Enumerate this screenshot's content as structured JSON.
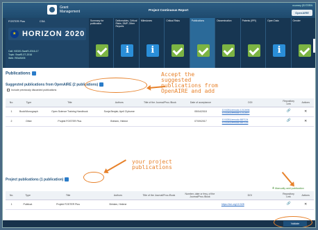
{
  "header": {
    "logo_text_1": "Grant",
    "logo_text_2": "Management",
    "report_title": "Project Continuous Report",
    "user": "ncurney (EXTERN",
    "brand": "OpenAIRE"
  },
  "project": {
    "acronym": "FOSTER Plus",
    "call": "CSA",
    "programme": "HORIZON 2020",
    "meta_1": "Call: H2020-SwafS-2016-17",
    "meta_2": "Topic: SwafS-07-2016",
    "meta_3": "Web: REA/B/05"
  },
  "tabs": [
    {
      "label": "Summary for publication",
      "status": "check"
    },
    {
      "label": "Deliverables, Critical Risks, DMP, Other Reports",
      "status": "info"
    },
    {
      "label": "Milestones",
      "status": "info"
    },
    {
      "label": "Critical Risks",
      "status": "check"
    },
    {
      "label": "Publications",
      "status": "check"
    },
    {
      "label": "Dissemination",
      "status": "check"
    },
    {
      "label": "Patents (IPR)",
      "status": "check"
    },
    {
      "label": "Open Data",
      "status": "info"
    },
    {
      "label": "Gender",
      "status": "check"
    }
  ],
  "publications": {
    "section_title": "Publications",
    "suggested_title": "Suggested publications from OpenAIRE (2 publications)",
    "include_discarded": "Include previously discarded publications",
    "save_label": "Save",
    "columns": [
      "No.",
      "Type",
      "Title",
      "Authors",
      "Title of the Journal/Proc./Book",
      "Date of acceptance",
      "DOI",
      "Repository Link",
      "Actions"
    ],
    "rows": [
      {
        "no": "1",
        "type": "Book/Monograph",
        "title": "Open Science Training Handbook",
        "authors": "Sonja Bezjak; April Clyburne",
        "journal": "",
        "date": "05/04/2018",
        "doi_1": "10.5281/zenodo.1212496",
        "doi_2": "10.5281/zenodo.1212497"
      },
      {
        "no": "2",
        "type": "Other",
        "title": "Projekt FOSTER Plus",
        "authors": "Brinken, Helene",
        "journal": "",
        "date": "07/09/2017",
        "doi_1": "10.5281/zenodo.887124",
        "doi_2": "10.5281/zenodo.887125"
      }
    ]
  },
  "project_pubs": {
    "title": "Project publications (1 publication)",
    "add_label": "Manually add publication",
    "validate_label": "Validate",
    "columns": [
      "No.",
      "Type",
      "Title",
      "Authors",
      "Title of the Journal/Proc./Book",
      "Number, date or freq. of the Journal/Proc./Book",
      "DOI",
      "Repository Link",
      "Actions"
    ],
    "rows": [
      {
        "no": "1",
        "type": "Publicat.",
        "title": "Projekt FOSTER Plus",
        "authors": "Brinken, Helene",
        "journal": "",
        "number": "",
        "doi": "https://doi.org/10.528"
      }
    ]
  },
  "annotations": {
    "accept": "Accept the\nsuggested\npublications from\nOpenAIRE and add",
    "yours": "your project\npublications"
  },
  "colors": {
    "accent": "#e7812a",
    "brand": "#1d4f7a",
    "check": "#7cb443",
    "info": "#2a8ed8"
  }
}
